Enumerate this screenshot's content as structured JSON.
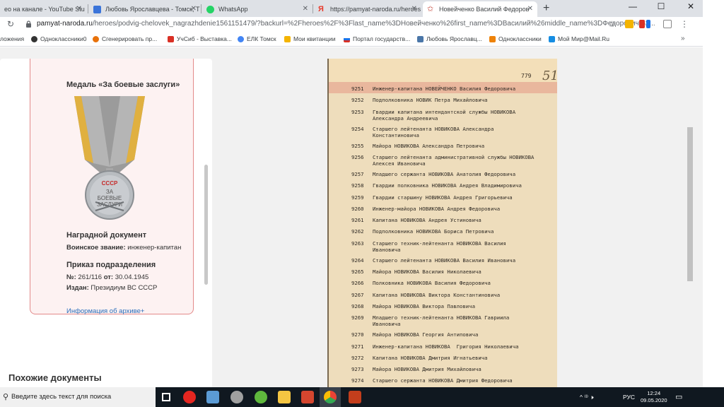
{
  "browser": {
    "tabs": [
      {
        "title": "ео на канале - YouTube Stu",
        "color": "#d93025"
      },
      {
        "title": "Любовь Ярославцева - Томск, Т",
        "color": "#3b74d9"
      },
      {
        "title": "WhatsApp",
        "color": "#25d366"
      },
      {
        "title": "https://pamyat-naroda.ru/heroes",
        "color": "#e8392a"
      },
      {
        "title": "Новейченко Василий Федоров",
        "color": "#c0392b"
      }
    ],
    "new_tab": "+",
    "controls": {
      "minimize": "—",
      "maximize": "☐",
      "close": "✕"
    },
    "url_domain": "pamyat-naroda.ru",
    "url_rest": "/heroes/podvig-chelovek_nagrazhdenie1561151479/?backurl=%2Fheroes%2F%3Flast_name%3DНовейченко%26first_name%3DВасилий%26middle_name%3DФедорович%2..."
  },
  "bookmarks": [
    {
      "label": "ложения",
      "color": "#4285f4"
    },
    {
      "label": "Одноклассники0",
      "color": "#333333"
    },
    {
      "label": "Сгенерировать пр...",
      "color": "#e8710a"
    },
    {
      "label": "УчСиб - Выставка...",
      "color": "#d93025"
    },
    {
      "label": "ЕЛК Томск",
      "color": "#4285f4"
    },
    {
      "label": "Мои квитанции",
      "color": "#f4b400"
    },
    {
      "label": "Портал государств...",
      "color": "#1a73e8"
    },
    {
      "label": "Любовь Ярославц...",
      "color": "#4a76a8"
    },
    {
      "label": "Одноклассники",
      "color": "#ee8208"
    },
    {
      "label": "Мой Мир@Mail.Ru",
      "color": "#168de2"
    }
  ],
  "bookmarks_more": "»",
  "award": {
    "medal_title": "Медаль «За боевые заслуги»",
    "medal_text": [
      "СССР",
      "ЗА",
      "БОЕВЫЕ",
      "ЗАСЛУГИ"
    ],
    "doc_title": "Наградной документ",
    "rank_label": "Воинское звание:",
    "rank_value": "инженер-капитан",
    "order_title": "Приказ подразделения",
    "num_label": "№:",
    "num_value": "261/116",
    "date_label": "от:",
    "date_value": "30.04.1945",
    "issued_label": "Издан:",
    "issued_value": "Президиум ВС СССР",
    "archive_link": "Информация об архиве+"
  },
  "similar_title": "Похожие документы",
  "scan": {
    "page_number": "779",
    "page_mark": "51",
    "rows": [
      {
        "n": "9251",
        "t": "Инженер-капитана НОВЕЙЧЕНКО Василия Федоровича"
      },
      {
        "n": "9252",
        "t": "Подполковника НОВИК Петра Михайловича"
      },
      {
        "n": "9253",
        "t": "Гвардии капитана интендантской службы НОВИКОВА\nАлександра Андреевича"
      },
      {
        "n": "9254",
        "t": "Старшего лейтенанта НОВИКОВА Александра\nКонстантиновича"
      },
      {
        "n": "9255",
        "t": "Майора НОВИКОВА Александра Петровича"
      },
      {
        "n": "9256",
        "t": "Старшего лейтенанта административной службы НОВИКОВА\nАлексея Ивановича"
      },
      {
        "n": "9257",
        "t": "Младшего сержанта НОВИКОВА Анатолия Федоровича"
      },
      {
        "n": "9258",
        "t": "Гвардии полковника НОВИКОВА Андрея Владимировича"
      },
      {
        "n": "9259",
        "t": "Гвардии старшину НОВИКОВА Андрея Григорьевича"
      },
      {
        "n": "9260",
        "t": "Инженер-майора НОВИКОВА Андрея Федоровича"
      },
      {
        "n": "9261",
        "t": "Капитана НОВИКОВА Андрея Устиновича"
      },
      {
        "n": "9262",
        "t": "Подполковника НОВИКОВА Бориса Петровича"
      },
      {
        "n": "9263",
        "t": "Старшего техник-лейтенанта НОВИКОВА Василия\nИвановича"
      },
      {
        "n": "9264",
        "t": "Старшего лейтенанта НОВИКОВА Василия Ивановича"
      },
      {
        "n": "9265",
        "t": "Майора НОВИКОВА Василия Николаевича"
      },
      {
        "n": "9266",
        "t": "Полковника НОВИКОВА Василия Федоровича"
      },
      {
        "n": "9267",
        "t": "Капитана НОВИКОВА Виктора Константиновича"
      },
      {
        "n": "9268",
        "t": "Майора НОВИКОВА Виктора Павловича"
      },
      {
        "n": "9269",
        "t": "Младшего техник-лейтенанта НОВИКОВА Гавриила\nИвановича"
      },
      {
        "n": "9270",
        "t": "Майора НОВИКОВА Георгия Антиповича"
      },
      {
        "n": "9271",
        "t": "Инженер-капитана НОВИКОВА  Григория Николаевича"
      },
      {
        "n": "9272",
        "t": "Капитана НОВИКОВА Дмитрия Игнатьевича"
      },
      {
        "n": "9273",
        "t": "Майора НОВИКОВА Дмитрия Михайловича"
      },
      {
        "n": "9274",
        "t": "Старшего сержанта НОВИКОВА Дмитрия Федоровича"
      }
    ]
  },
  "scroll_top_icon": "⌃",
  "taskbar": {
    "search_placeholder": "Введите здесь текст для поиска",
    "apps": [
      {
        "name": "task-view",
        "color": "#ffffff"
      },
      {
        "name": "yandex-browser",
        "color": "#e52620"
      },
      {
        "name": "image-viewer",
        "color": "#5b9bd5"
      },
      {
        "name": "tool-app",
        "color": "#a0a0a0"
      },
      {
        "name": "torrent",
        "color": "#5fb83d"
      },
      {
        "name": "file-explorer",
        "color": "#f4c542"
      },
      {
        "name": "office-app",
        "color": "#d4462f"
      },
      {
        "name": "chrome",
        "color": "#4285f4"
      },
      {
        "name": "powerpoint",
        "color": "#c43e1c"
      }
    ],
    "tray_lang": "РУС",
    "tray_icons": "^ ⁽ᴵ⁾ 🕨",
    "time": "12:24",
    "date": "09.05.2020"
  }
}
